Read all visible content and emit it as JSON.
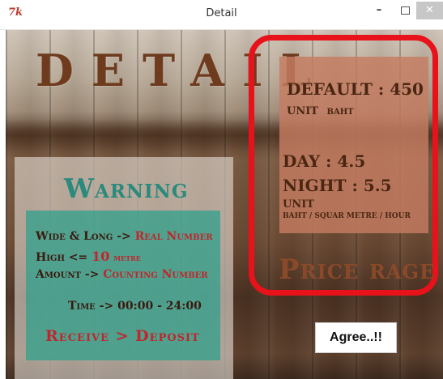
{
  "window": {
    "title": "Detail",
    "app_icon_text": "7k",
    "minimize_glyph": "–",
    "close_glyph": "✕"
  },
  "header": {
    "title": "DETAIL"
  },
  "warning": {
    "heading": "Warning",
    "line1_label": "Wide & Long ->",
    "line1_value": "Real  Number",
    "line2_label": "High  <=",
    "line2_value": "10",
    "line2_unit": "metre",
    "line3_label": "Amount ->",
    "line3_value": "Counting  Number",
    "time": "Time -> 00:00 - 24:00",
    "footer": "Receive  >  Deposit"
  },
  "price": {
    "default": "DEFAULT : 450",
    "unit_label_1": "UNIT",
    "unit_value_1": "BAHT",
    "day": "DAY : 4.5",
    "night": "NIGHT : 5.5",
    "unit_label_2": "UNIT",
    "unit_value_2": "BAHT / SQUAR METRE / HOUR",
    "range_label": "Price  rage"
  },
  "actions": {
    "agree_label": "Agree..!!"
  },
  "colors": {
    "teal": "#2a8a7c",
    "red": "#c0262c",
    "ring": "#e8121a",
    "brown": "#6e3b1e"
  },
  "icons": [
    "tk-logo-icon",
    "minimize-icon",
    "maximize-icon",
    "close-icon"
  ]
}
